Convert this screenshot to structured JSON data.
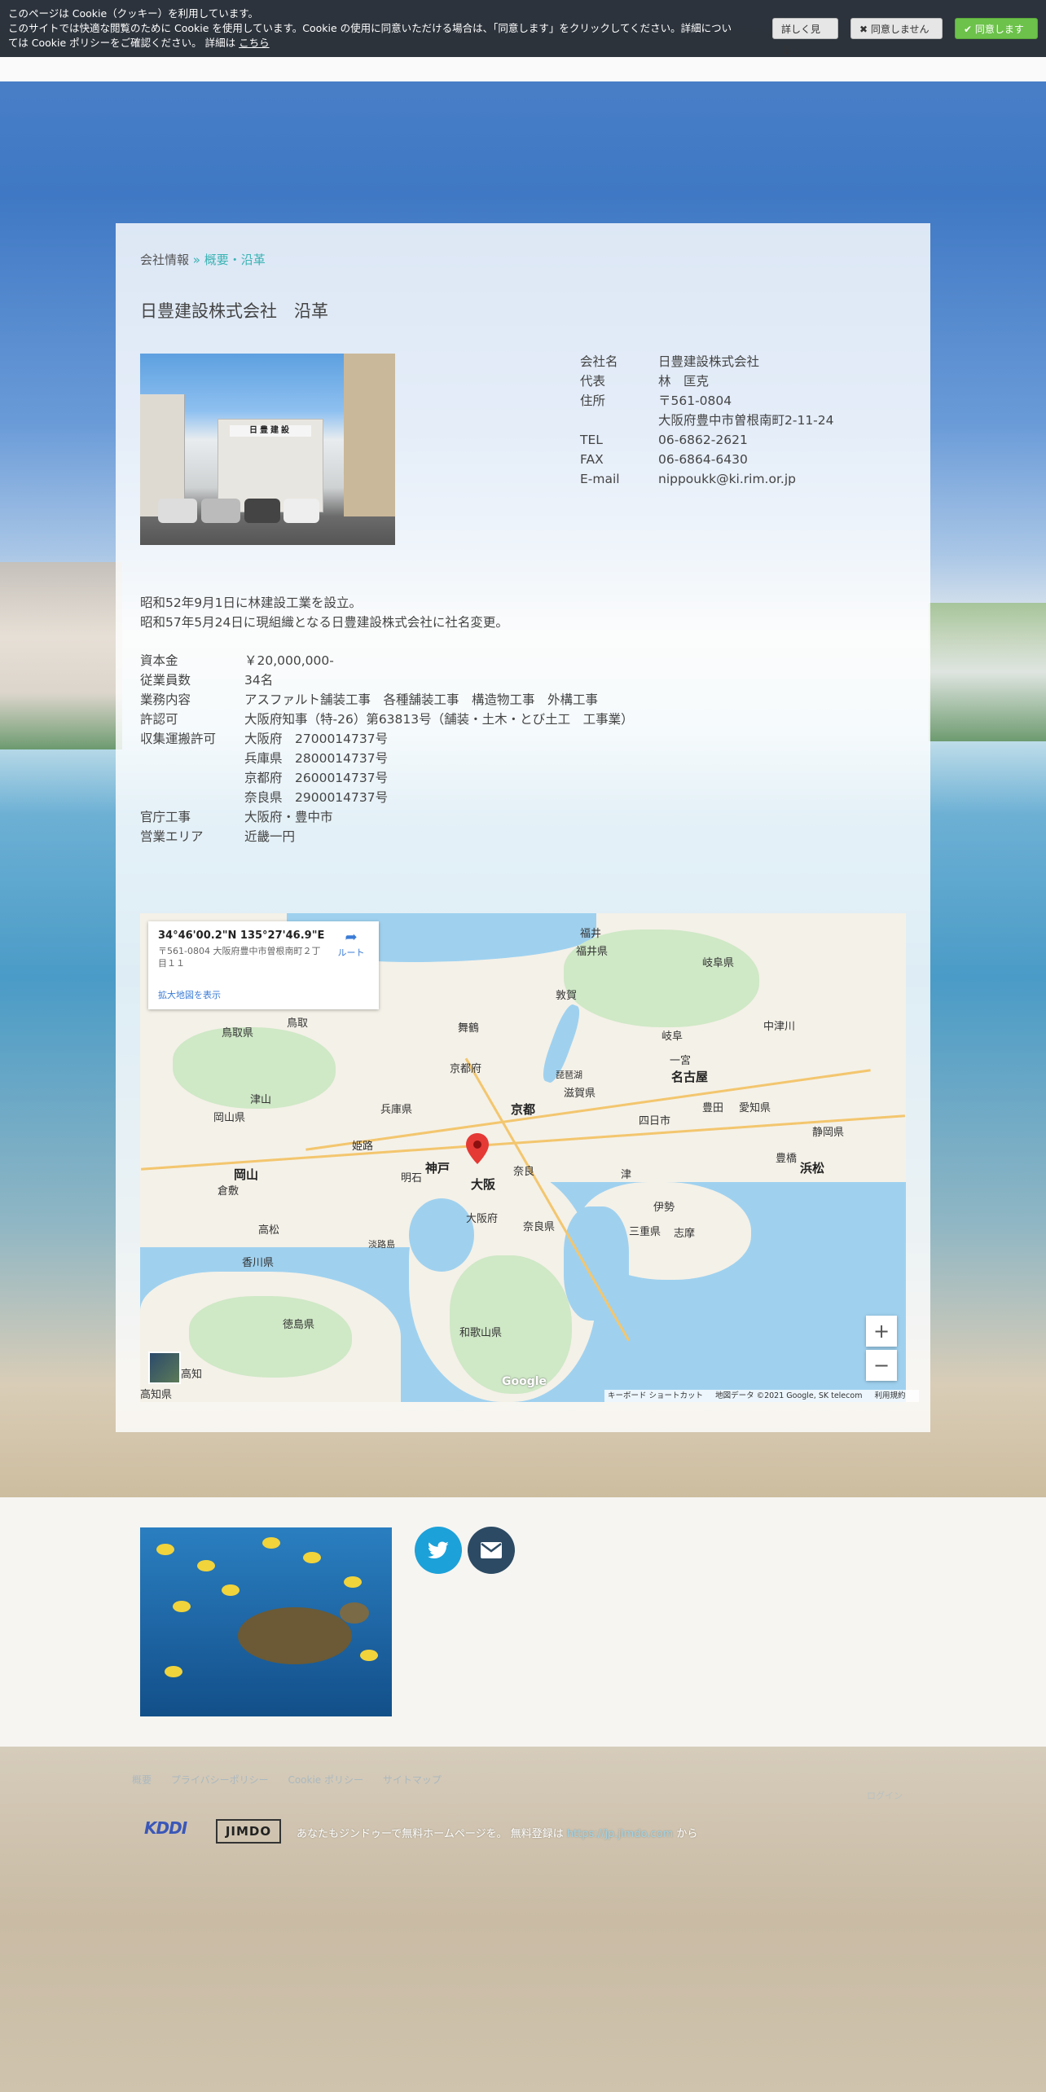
{
  "cookie": {
    "line1": "このページは Cookie（クッキー）を利用しています。",
    "line2": "このサイトでは快適な閲覧のために Cookie を使用しています。Cookie の使用に同意いただける場合は、「同意します」をクリックしてください。詳細については Cookie ポリシーをご確認ください。 詳細は",
    "link": "こちら",
    "more_label": "詳しく見る",
    "decline_label": "✖ 同意しません",
    "accept_label": "✔ 同意します"
  },
  "breadcrumb": {
    "parent": "会社情報",
    "separator": "»",
    "current": "概要・沿革"
  },
  "page_title": "日豊建設株式会社　沿革",
  "photo": {
    "sign_text": "日豊建設"
  },
  "company_info": [
    {
      "key": "会社名",
      "value": "日豊建設株式会社"
    },
    {
      "key": "代表",
      "value": "林　匡克"
    },
    {
      "key": "住所",
      "value": "〒561-0804"
    },
    {
      "key": "",
      "value": "大阪府豊中市曽根南町2-11-24"
    },
    {
      "key": "TEL",
      "value": " 06-6862-2621"
    },
    {
      "key": "FAX",
      "value": " 06-6864-6430"
    },
    {
      "key": "E-mail",
      "value": " nippoukk@ki.rim.or.jp"
    }
  ],
  "history": [
    "昭和52年9月1日に林建設工業を設立。",
    "昭和57年5月24日に現組織となる日豊建設株式会社に社名変更。"
  ],
  "spec": [
    {
      "key": "資本金",
      "value": "￥20,000,000-"
    },
    {
      "key": "従業員数",
      "value": "34名"
    },
    {
      "key": "業務内容",
      "value": "アスファルト舗装工事　各種舗装工事　構造物工事　外構工事"
    },
    {
      "key": "許認可",
      "value": "大阪府知事（特-26）第63813号（舗装・土木・とび土工　工事業）"
    },
    {
      "key": "収集運搬許可",
      "value": "大阪府　2700014737号"
    },
    {
      "key": "",
      "value": "兵庫県　2800014737号"
    },
    {
      "key": "",
      "value": "京都府　2600014737号"
    },
    {
      "key": "",
      "value": "奈良県　2900014737号"
    },
    {
      "key": "官庁工事",
      "value": "大阪府・豊中市"
    },
    {
      "key": "営業エリア",
      "value": "近畿一円"
    }
  ],
  "map": {
    "coords": "34°46'00.2\"N 135°27'46.9\"E",
    "address": "〒561-0804 大阪府豊中市曽根南町２丁目１１",
    "route_label": "ルート",
    "larger_map_label": "拡大地図を表示",
    "zoom_in": "+",
    "zoom_out": "−",
    "google": "Google",
    "footer_keyboard": "キーボード ショートカット",
    "footer_data": "地図データ ©2021 Google, SK telecom",
    "footer_terms": "利用規約",
    "places": {
      "fukui_city": "福井",
      "fukui_pref": "福井県",
      "gifu_pref": "岐阜県",
      "kyoto_city": "京都",
      "kyoto_pref": "京都府",
      "shiga_pref": "滋賀県",
      "osaka_city": "大阪",
      "osaka_pref": "大阪府",
      "kobe": "神戸",
      "hyogo_pref": "兵庫県",
      "nara": "奈良",
      "nara_pref": "奈良県",
      "nagoya": "名古屋",
      "aichi": "愛知県",
      "shizuoka_pref": "静岡県",
      "hamamatsu": "浜松",
      "okayama": "岡山",
      "okayama_pref": "岡山県",
      "tottori_pref": "鳥取県",
      "tottori": "鳥取",
      "himeji": "姫路",
      "wakayama_pref": "和歌山県",
      "tokushima_pref": "徳島県",
      "kagawa_pref": "香川県",
      "kochi_pref": "高知県",
      "kochi": "高知",
      "mie": "三重県",
      "tsuruga": "敦賀",
      "maizuru": "舞鶴",
      "gifu": "岐阜",
      "takamatsu": "高松",
      "akashi": "明石",
      "ichinomiya": "一宮",
      "toyota": "豊田",
      "toyohashi": "豊橋",
      "tsu": "津",
      "ise": "伊勢",
      "kurashiki": "倉敷",
      "tsuyama": "津山",
      "awaji": "淡路島",
      "yokkaichi": "四日市",
      "lake": "琵琶湖",
      "nakatsugawa": "中津川",
      "shika": "志摩"
    }
  },
  "footer": {
    "links": [
      "概要",
      "プライバシーポリシー",
      "Cookie ポリシー",
      "サイトマップ"
    ],
    "login": "ログイン",
    "kddi": "KDDI",
    "jimdo": "JIMDO",
    "promo": "あなたもジンドゥーで無料ホームページを。 無料登録は",
    "promo_link": "https://jp.jimdo.com",
    "promo_tail": "から"
  },
  "colors": {
    "accent": "#3ab3b3",
    "twitter": "#1da1d9",
    "mail": "#2c4a63",
    "accept_green": "#6cc24a"
  }
}
